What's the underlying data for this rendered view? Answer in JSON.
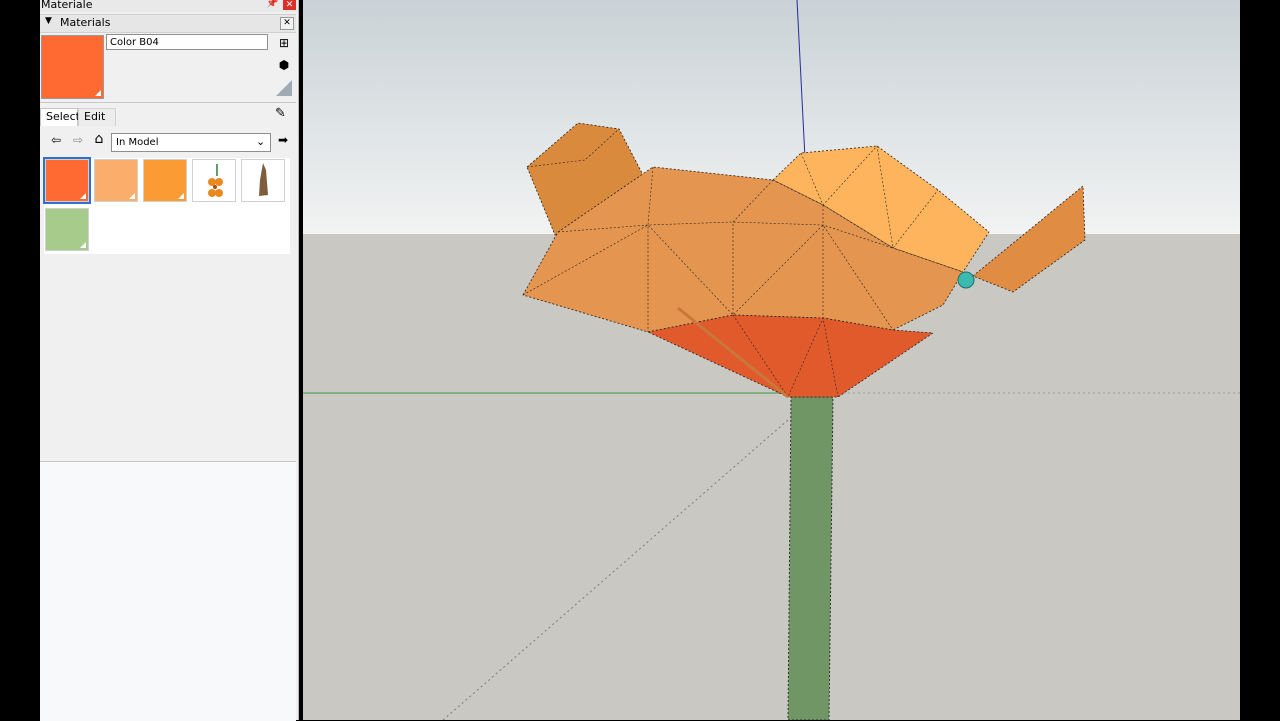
{
  "window": {
    "tray_title": "Materiale"
  },
  "materials": {
    "section_title": "Materials",
    "current_material_name": "Color B04",
    "current_color": "#ff6a33",
    "tabs": [
      {
        "label": "Select"
      },
      {
        "label": "Edit"
      }
    ],
    "collection": "In Model",
    "swatches": [
      {
        "color": "#ff6a33",
        "selected": true
      },
      {
        "color": "#fbad6c"
      },
      {
        "color": "#fb9b34"
      },
      {
        "texture": "flower-image"
      },
      {
        "texture": "brown-vase-image"
      },
      {
        "color": "#a7cb8b"
      }
    ]
  },
  "icons": {
    "pin": "pin-icon",
    "close": "close-icon",
    "collapse": "triangle-down-icon",
    "create_material": "create-material-icon",
    "add_to_model": "add-material-icon",
    "sample": "sample-paint-icon",
    "back": "back-arrow-icon",
    "forward": "forward-arrow-icon",
    "home": "home-icon",
    "dropdown": "chevron-down-icon",
    "details": "details-arrow-icon"
  },
  "colors": {
    "petal_light": "#f7a850",
    "petal_mid": "#e4954f",
    "petal_top": "#fdb45c",
    "cup_red": "#e05a2c",
    "stem_green": "#6f9664",
    "axis_blue": "#2a2aa0",
    "axis_green": "#3c9c3c"
  }
}
